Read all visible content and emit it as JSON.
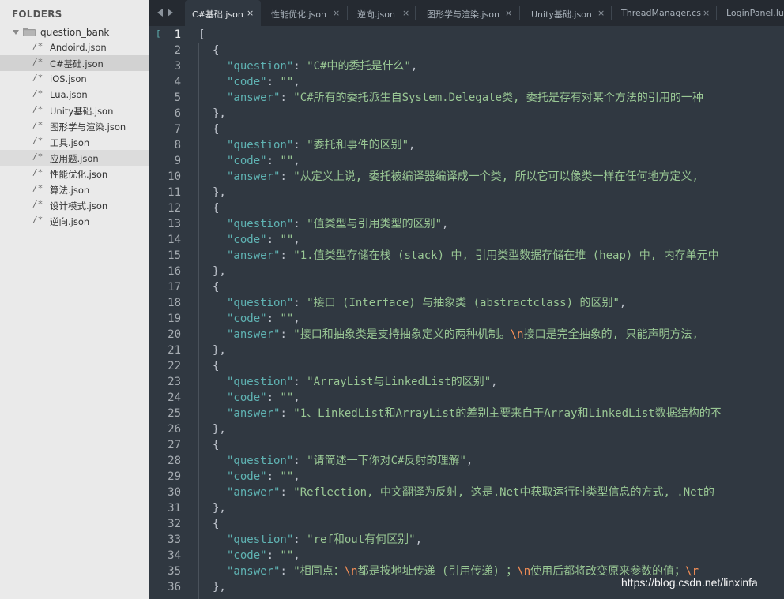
{
  "sidebar": {
    "title": "FOLDERS",
    "folder": "question_bank",
    "file_icon": "/*",
    "files": [
      {
        "name": "Andoird.json",
        "state": ""
      },
      {
        "name": "C#基础.json",
        "state": "selected"
      },
      {
        "name": "iOS.json",
        "state": ""
      },
      {
        "name": "Lua.json",
        "state": ""
      },
      {
        "name": "Unity基础.json",
        "state": ""
      },
      {
        "name": "图形学与渲染.json",
        "state": ""
      },
      {
        "name": "工具.json",
        "state": ""
      },
      {
        "name": "应用题.json",
        "state": "soft"
      },
      {
        "name": "性能优化.json",
        "state": ""
      },
      {
        "name": "算法.json",
        "state": ""
      },
      {
        "name": "设计模式.json",
        "state": ""
      },
      {
        "name": "逆向.json",
        "state": ""
      }
    ]
  },
  "tabs": [
    {
      "label": "C#基础.json",
      "active": true,
      "close": "×"
    },
    {
      "label": "性能优化.json",
      "active": false,
      "close": "×"
    },
    {
      "label": "逆向.json",
      "active": false,
      "close": "×"
    },
    {
      "label": "图形学与渲染.json",
      "active": false,
      "close": "×"
    },
    {
      "label": "Unity基础.json",
      "active": false,
      "close": "×"
    },
    {
      "label": "ThreadManager.cs",
      "active": false,
      "close": "×"
    },
    {
      "label": "LoginPanel.lua",
      "active": false,
      "close": ""
    }
  ],
  "editor": {
    "fold_marker": "[",
    "current_line": 1,
    "lines": [
      {
        "indent": 0,
        "parts": [
          {
            "t": "[",
            "c": "p"
          }
        ]
      },
      {
        "indent": 1,
        "parts": [
          {
            "t": "{",
            "c": "p"
          }
        ]
      },
      {
        "indent": 2,
        "parts": [
          {
            "t": "\"question\"",
            "c": "k"
          },
          {
            "t": ": ",
            "c": "p"
          },
          {
            "t": "\"C#中的委托是什么\"",
            "c": "s"
          },
          {
            "t": ",",
            "c": "p"
          }
        ]
      },
      {
        "indent": 2,
        "parts": [
          {
            "t": "\"code\"",
            "c": "k"
          },
          {
            "t": ": ",
            "c": "p"
          },
          {
            "t": "\"\"",
            "c": "s"
          },
          {
            "t": ",",
            "c": "p"
          }
        ]
      },
      {
        "indent": 2,
        "parts": [
          {
            "t": "\"answer\"",
            "c": "k"
          },
          {
            "t": ": ",
            "c": "p"
          },
          {
            "t": "\"C#所有的委托派生自System.Delegate类, 委托是存有对某个方法的引用的一种",
            "c": "s"
          }
        ]
      },
      {
        "indent": 1,
        "parts": [
          {
            "t": "},",
            "c": "p"
          }
        ]
      },
      {
        "indent": 1,
        "parts": [
          {
            "t": "{",
            "c": "p"
          }
        ]
      },
      {
        "indent": 2,
        "parts": [
          {
            "t": "\"question\"",
            "c": "k"
          },
          {
            "t": ": ",
            "c": "p"
          },
          {
            "t": "\"委托和事件的区别\"",
            "c": "s"
          },
          {
            "t": ",",
            "c": "p"
          }
        ]
      },
      {
        "indent": 2,
        "parts": [
          {
            "t": "\"code\"",
            "c": "k"
          },
          {
            "t": ": ",
            "c": "p"
          },
          {
            "t": "\"\"",
            "c": "s"
          },
          {
            "t": ",",
            "c": "p"
          }
        ]
      },
      {
        "indent": 2,
        "parts": [
          {
            "t": "\"answer\"",
            "c": "k"
          },
          {
            "t": ": ",
            "c": "p"
          },
          {
            "t": "\"从定义上说, 委托被编译器编译成一个类, 所以它可以像类一样在任何地方定义,",
            "c": "s"
          }
        ]
      },
      {
        "indent": 1,
        "parts": [
          {
            "t": "},",
            "c": "p"
          }
        ]
      },
      {
        "indent": 1,
        "parts": [
          {
            "t": "{",
            "c": "p"
          }
        ]
      },
      {
        "indent": 2,
        "parts": [
          {
            "t": "\"question\"",
            "c": "k"
          },
          {
            "t": ": ",
            "c": "p"
          },
          {
            "t": "\"值类型与引用类型的区别\"",
            "c": "s"
          },
          {
            "t": ",",
            "c": "p"
          }
        ]
      },
      {
        "indent": 2,
        "parts": [
          {
            "t": "\"code\"",
            "c": "k"
          },
          {
            "t": ": ",
            "c": "p"
          },
          {
            "t": "\"\"",
            "c": "s"
          },
          {
            "t": ",",
            "c": "p"
          }
        ]
      },
      {
        "indent": 2,
        "parts": [
          {
            "t": "\"answer\"",
            "c": "k"
          },
          {
            "t": ": ",
            "c": "p"
          },
          {
            "t": "\"1.值类型存储在栈 (stack) 中, 引用类型数据存储在堆 (heap) 中, 内存单元中",
            "c": "s"
          }
        ]
      },
      {
        "indent": 1,
        "parts": [
          {
            "t": "},",
            "c": "p"
          }
        ]
      },
      {
        "indent": 1,
        "parts": [
          {
            "t": "{",
            "c": "p"
          }
        ]
      },
      {
        "indent": 2,
        "parts": [
          {
            "t": "\"question\"",
            "c": "k"
          },
          {
            "t": ": ",
            "c": "p"
          },
          {
            "t": "\"接口 (Interface) 与抽象类 (abstractclass) 的区别\"",
            "c": "s"
          },
          {
            "t": ",",
            "c": "p"
          }
        ]
      },
      {
        "indent": 2,
        "parts": [
          {
            "t": "\"code\"",
            "c": "k"
          },
          {
            "t": ": ",
            "c": "p"
          },
          {
            "t": "\"\"",
            "c": "s"
          },
          {
            "t": ",",
            "c": "p"
          }
        ]
      },
      {
        "indent": 2,
        "parts": [
          {
            "t": "\"answer\"",
            "c": "k"
          },
          {
            "t": ": ",
            "c": "p"
          },
          {
            "t": "\"接口和抽象类是支持抽象定义的两种机制。",
            "c": "s"
          },
          {
            "t": "\\n",
            "c": "e"
          },
          {
            "t": "接口是完全抽象的, 只能声明方法,",
            "c": "s"
          }
        ]
      },
      {
        "indent": 1,
        "parts": [
          {
            "t": "},",
            "c": "p"
          }
        ]
      },
      {
        "indent": 1,
        "parts": [
          {
            "t": "{",
            "c": "p"
          }
        ]
      },
      {
        "indent": 2,
        "parts": [
          {
            "t": "\"question\"",
            "c": "k"
          },
          {
            "t": ": ",
            "c": "p"
          },
          {
            "t": "\"ArrayList与LinkedList的区别\"",
            "c": "s"
          },
          {
            "t": ",",
            "c": "p"
          }
        ]
      },
      {
        "indent": 2,
        "parts": [
          {
            "t": "\"code\"",
            "c": "k"
          },
          {
            "t": ": ",
            "c": "p"
          },
          {
            "t": "\"\"",
            "c": "s"
          },
          {
            "t": ",",
            "c": "p"
          }
        ]
      },
      {
        "indent": 2,
        "parts": [
          {
            "t": "\"answer\"",
            "c": "k"
          },
          {
            "t": ": ",
            "c": "p"
          },
          {
            "t": "\"1、LinkedList和ArrayList的差别主要来自于Array和LinkedList数据结构的不",
            "c": "s"
          }
        ]
      },
      {
        "indent": 1,
        "parts": [
          {
            "t": "},",
            "c": "p"
          }
        ]
      },
      {
        "indent": 1,
        "parts": [
          {
            "t": "{",
            "c": "p"
          }
        ]
      },
      {
        "indent": 2,
        "parts": [
          {
            "t": "\"question\"",
            "c": "k"
          },
          {
            "t": ": ",
            "c": "p"
          },
          {
            "t": "\"请简述一下你对C#反射的理解\"",
            "c": "s"
          },
          {
            "t": ",",
            "c": "p"
          }
        ]
      },
      {
        "indent": 2,
        "parts": [
          {
            "t": "\"code\"",
            "c": "k"
          },
          {
            "t": ": ",
            "c": "p"
          },
          {
            "t": "\"\"",
            "c": "s"
          },
          {
            "t": ",",
            "c": "p"
          }
        ]
      },
      {
        "indent": 2,
        "parts": [
          {
            "t": "\"answer\"",
            "c": "k"
          },
          {
            "t": ": ",
            "c": "p"
          },
          {
            "t": "\"Reflection, 中文翻译为反射, 这是.Net中获取运行时类型信息的方式, .Net的",
            "c": "s"
          }
        ]
      },
      {
        "indent": 1,
        "parts": [
          {
            "t": "},",
            "c": "p"
          }
        ]
      },
      {
        "indent": 1,
        "parts": [
          {
            "t": "{",
            "c": "p"
          }
        ]
      },
      {
        "indent": 2,
        "parts": [
          {
            "t": "\"question\"",
            "c": "k"
          },
          {
            "t": ": ",
            "c": "p"
          },
          {
            "t": "\"ref和out有何区别\"",
            "c": "s"
          },
          {
            "t": ",",
            "c": "p"
          }
        ]
      },
      {
        "indent": 2,
        "parts": [
          {
            "t": "\"code\"",
            "c": "k"
          },
          {
            "t": ": ",
            "c": "p"
          },
          {
            "t": "\"\"",
            "c": "s"
          },
          {
            "t": ",",
            "c": "p"
          }
        ]
      },
      {
        "indent": 2,
        "parts": [
          {
            "t": "\"answer\"",
            "c": "k"
          },
          {
            "t": ": ",
            "c": "p"
          },
          {
            "t": "\"相同点：",
            "c": "s"
          },
          {
            "t": "\\n",
            "c": "e"
          },
          {
            "t": "都是按地址传递 (引用传递) ；",
            "c": "s"
          },
          {
            "t": "\\n",
            "c": "e"
          },
          {
            "t": "使用后都将改变原来参数的值；",
            "c": "s"
          },
          {
            "t": "\\r",
            "c": "e"
          }
        ]
      },
      {
        "indent": 1,
        "parts": [
          {
            "t": "},",
            "c": "p"
          }
        ]
      }
    ]
  },
  "watermark": "https://blog.csdn.net/linxinfa",
  "colors": {
    "editor_bg": "#303841",
    "sidebar_bg": "#eaeaea",
    "key": "#5fb3b3",
    "string": "#99c794",
    "escape": "#f99157"
  }
}
